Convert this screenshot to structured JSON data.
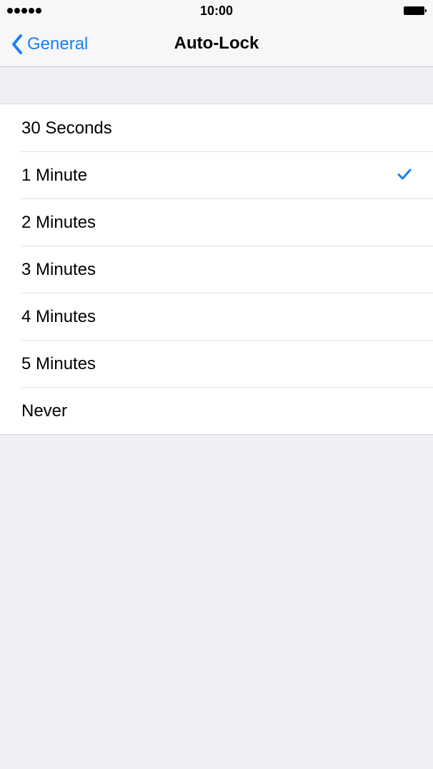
{
  "status_bar": {
    "time": "10:00",
    "signal_dots": 5
  },
  "nav": {
    "back_label": "General",
    "title": "Auto-Lock",
    "accent_color": "#1b7ef7"
  },
  "options": [
    {
      "label": "30 Seconds",
      "selected": false
    },
    {
      "label": "1 Minute",
      "selected": true
    },
    {
      "label": "2 Minutes",
      "selected": false
    },
    {
      "label": "3 Minutes",
      "selected": false
    },
    {
      "label": "4 Minutes",
      "selected": false
    },
    {
      "label": "5 Minutes",
      "selected": false
    },
    {
      "label": "Never",
      "selected": false
    }
  ],
  "icons": {
    "back": "chevron-left-icon",
    "selected": "checkmark-icon",
    "battery": "battery-icon",
    "signal": "signal-strength-icon"
  }
}
